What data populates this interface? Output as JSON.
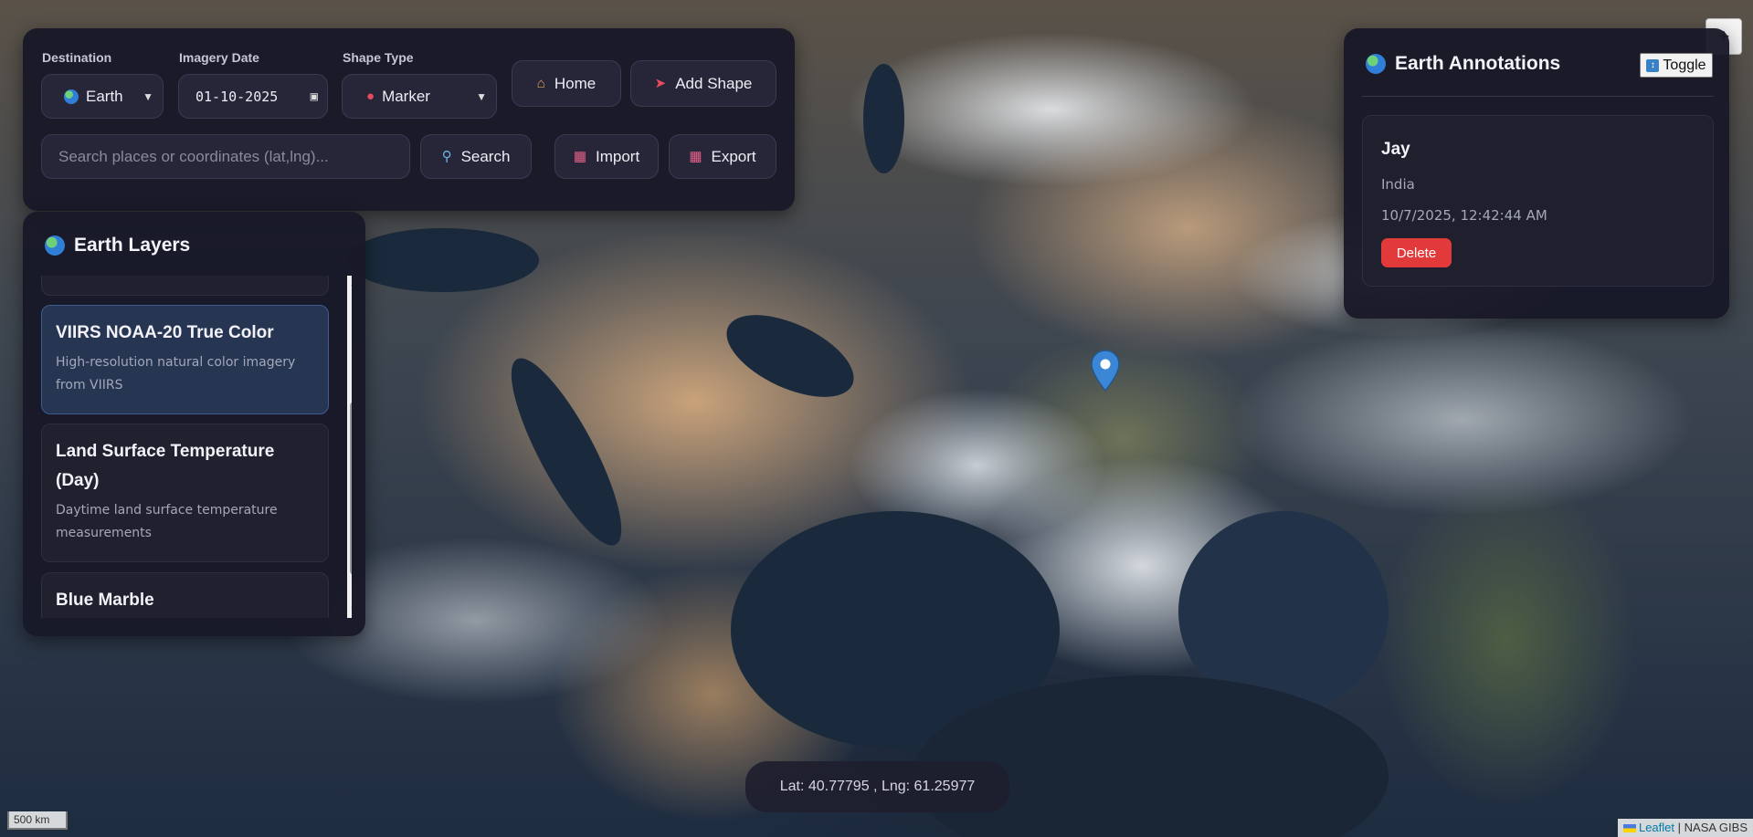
{
  "toolbar": {
    "destination_label": "Destination",
    "destination_value": "Earth",
    "imagery_date_label": "Imagery Date",
    "imagery_date_value": "01-10-2025",
    "shape_type_label": "Shape Type",
    "shape_type_value": "Marker",
    "home_label": "Home",
    "add_shape_label": "Add Shape",
    "search_placeholder": "Search places or coordinates (lat,lng)...",
    "search_label": "Search",
    "import_label": "Import",
    "export_label": "Export"
  },
  "layers_panel": {
    "title": "Earth Layers",
    "items": [
      {
        "name": "",
        "description": ""
      },
      {
        "name": "VIIRS NOAA-20 True Color",
        "description": "High-resolution natural color imagery from VIIRS",
        "active": true
      },
      {
        "name": "Land Surface Temperature (Day)",
        "description": "Daytime land surface temperature measurements"
      },
      {
        "name": "Blue Marble",
        "description": ""
      }
    ]
  },
  "annotations_panel": {
    "title": "Earth Annotations",
    "toggle_label": "Toggle",
    "items": [
      {
        "name": "Jay",
        "place": "India",
        "timestamp": "10/7/2025, 12:42:44 AM",
        "delete_label": "Delete"
      }
    ]
  },
  "map": {
    "coordinates": "Lat: 40.77795 , Lng: 61.25977",
    "scale_label": "500 km",
    "attribution_link": "Leaflet",
    "attribution_text": "| NASA GIBS",
    "marker_color": "#3b87d6"
  },
  "colors": {
    "panel_bg": "#181828",
    "active_layer": "#263552",
    "delete": "#e23a3a"
  }
}
